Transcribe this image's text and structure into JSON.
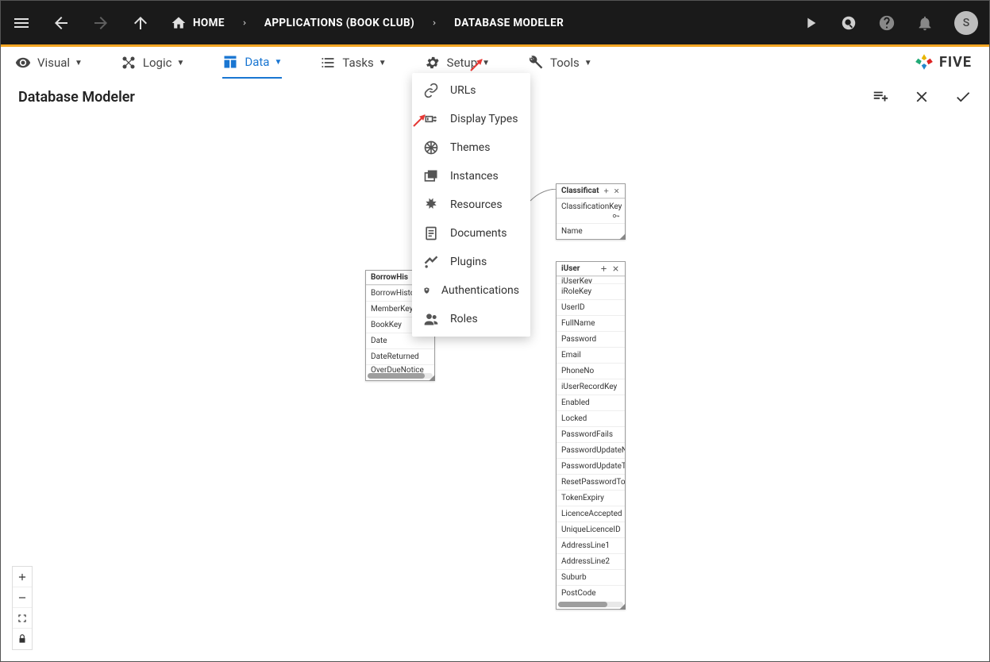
{
  "breadcrumbs": {
    "home": "HOME",
    "apps": "APPLICATIONS (BOOK CLUB)",
    "modeler": "DATABASE MODELER"
  },
  "avatar_letter": "S",
  "menubar": {
    "visual": "Visual",
    "logic": "Logic",
    "data": "Data",
    "tasks": "Tasks",
    "setup": "Setup",
    "tools": "Tools"
  },
  "brand": "FIVE",
  "page_title": "Database Modeler",
  "dropdown": {
    "urls": "URLs",
    "display_types": "Display Types",
    "themes": "Themes",
    "instances": "Instances",
    "resources": "Resources",
    "documents": "Documents",
    "plugins": "Plugins",
    "authentications": "Authentications",
    "roles": "Roles"
  },
  "tables": {
    "borrow": {
      "title": "BorrowHis",
      "rows": [
        "BorrowHistoryK",
        "MemberKey",
        "BookKey",
        "Date",
        "DateReturned",
        "OverDueNotice"
      ]
    },
    "classificat": {
      "title": "Classificat",
      "rows": [
        "ClassificationKey",
        "Name"
      ]
    },
    "iuser": {
      "title": "iUser",
      "rows": [
        "iUserKey",
        "iRoleKey",
        "UserID",
        "FullName",
        "Password",
        "Email",
        "PhoneNo",
        "iUserRecordKey",
        "Enabled",
        "Locked",
        "PasswordFails",
        "PasswordUpdateNext",
        "PasswordUpdateTime",
        "ResetPasswordToken",
        "TokenExpiry",
        "LicenceAccepted",
        "UniqueLicenceID",
        "AddressLine1",
        "AddressLine2",
        "Suburb",
        "PostCode"
      ]
    }
  }
}
